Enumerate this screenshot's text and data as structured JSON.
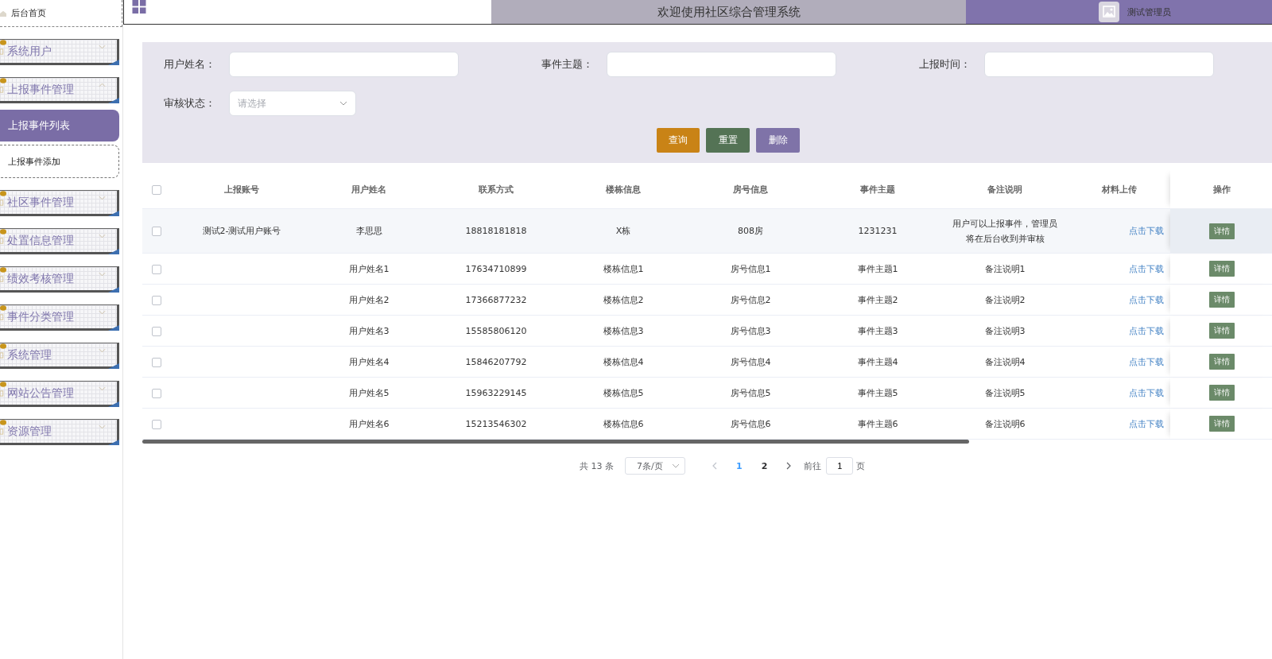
{
  "sidebar": {
    "items": [
      {
        "label": "后台首页",
        "kind": "link"
      },
      {
        "label": "系统用户",
        "kind": "group",
        "expanded": false
      },
      {
        "label": "上报事件管理",
        "kind": "group",
        "expanded": true,
        "children": [
          {
            "label": "上报事件列表",
            "selected": true
          },
          {
            "label": "上报事件添加",
            "selected": false
          }
        ]
      },
      {
        "label": "社区事件管理",
        "kind": "group",
        "expanded": false
      },
      {
        "label": "处置信息管理",
        "kind": "group",
        "expanded": false
      },
      {
        "label": "绩效考核管理",
        "kind": "group",
        "expanded": false
      },
      {
        "label": "事件分类管理",
        "kind": "group",
        "expanded": false
      },
      {
        "label": "系统管理",
        "kind": "group",
        "expanded": false
      },
      {
        "label": "网站公告管理",
        "kind": "group",
        "expanded": false
      },
      {
        "label": "资源管理",
        "kind": "group",
        "expanded": false
      }
    ]
  },
  "header": {
    "title": "欢迎使用社区综合管理系统",
    "user": "测试管理员"
  },
  "filters": {
    "fields": [
      {
        "label": "用户姓名：",
        "kind": "text"
      },
      {
        "label": "事件主题：",
        "kind": "text"
      },
      {
        "label": "上报时间：",
        "kind": "text"
      },
      {
        "label": "审核状态：",
        "kind": "select",
        "placeholder": "请选择"
      }
    ],
    "buttons": [
      {
        "label": "查询",
        "kind": "search"
      },
      {
        "label": "重置",
        "kind": "reset"
      },
      {
        "label": "删除",
        "kind": "delete"
      }
    ]
  },
  "table": {
    "all_checked": false,
    "columns": [
      "上报账号",
      "用户姓名",
      "联系方式",
      "楼栋信息",
      "房号信息",
      "事件主题",
      "备注说明",
      "材料上传",
      "操作"
    ],
    "rows": [
      {
        "checked": false,
        "highlighted": true,
        "cells": [
          "测试2-测试用户账号",
          "李思思",
          "18818181818",
          "X栋",
          "808房",
          "1231231",
          "用户可以上报事件，管理员将在后台收到并审核"
        ],
        "link": "点击下载",
        "action": "详情"
      },
      {
        "checked": false,
        "highlighted": false,
        "cells": [
          "",
          "用户姓名1",
          "17634710899",
          "楼栋信息1",
          "房号信息1",
          "事件主题1",
          "备注说明1"
        ],
        "link": "点击下载",
        "action": "详情"
      },
      {
        "checked": false,
        "highlighted": false,
        "cells": [
          "",
          "用户姓名2",
          "17366877232",
          "楼栋信息2",
          "房号信息2",
          "事件主题2",
          "备注说明2"
        ],
        "link": "点击下载",
        "action": "详情"
      },
      {
        "checked": false,
        "highlighted": false,
        "cells": [
          "",
          "用户姓名3",
          "15585806120",
          "楼栋信息3",
          "房号信息3",
          "事件主题3",
          "备注说明3"
        ],
        "link": "点击下载",
        "action": "详情"
      },
      {
        "checked": false,
        "highlighted": false,
        "cells": [
          "",
          "用户姓名4",
          "15846207792",
          "楼栋信息4",
          "房号信息4",
          "事件主题4",
          "备注说明4"
        ],
        "link": "点击下载",
        "action": "详情"
      },
      {
        "checked": false,
        "highlighted": false,
        "cells": [
          "",
          "用户姓名5",
          "15963229145",
          "楼栋信息5",
          "房号信息5",
          "事件主题5",
          "备注说明5"
        ],
        "link": "点击下载",
        "action": "详情"
      },
      {
        "checked": false,
        "highlighted": false,
        "cells": [
          "",
          "用户姓名6",
          "15213546302",
          "楼栋信息6",
          "房号信息6",
          "事件主题6",
          "备注说明6"
        ],
        "link": "点击下载",
        "action": "详情"
      }
    ]
  },
  "pagination": {
    "total": "共 13 条",
    "page_size": "7条/页",
    "pages": [
      {
        "label": "1",
        "selected": true
      },
      {
        "label": "2",
        "selected": false
      }
    ],
    "goto_label": "前往",
    "goto_value": "1",
    "goto_suffix": "页"
  }
}
